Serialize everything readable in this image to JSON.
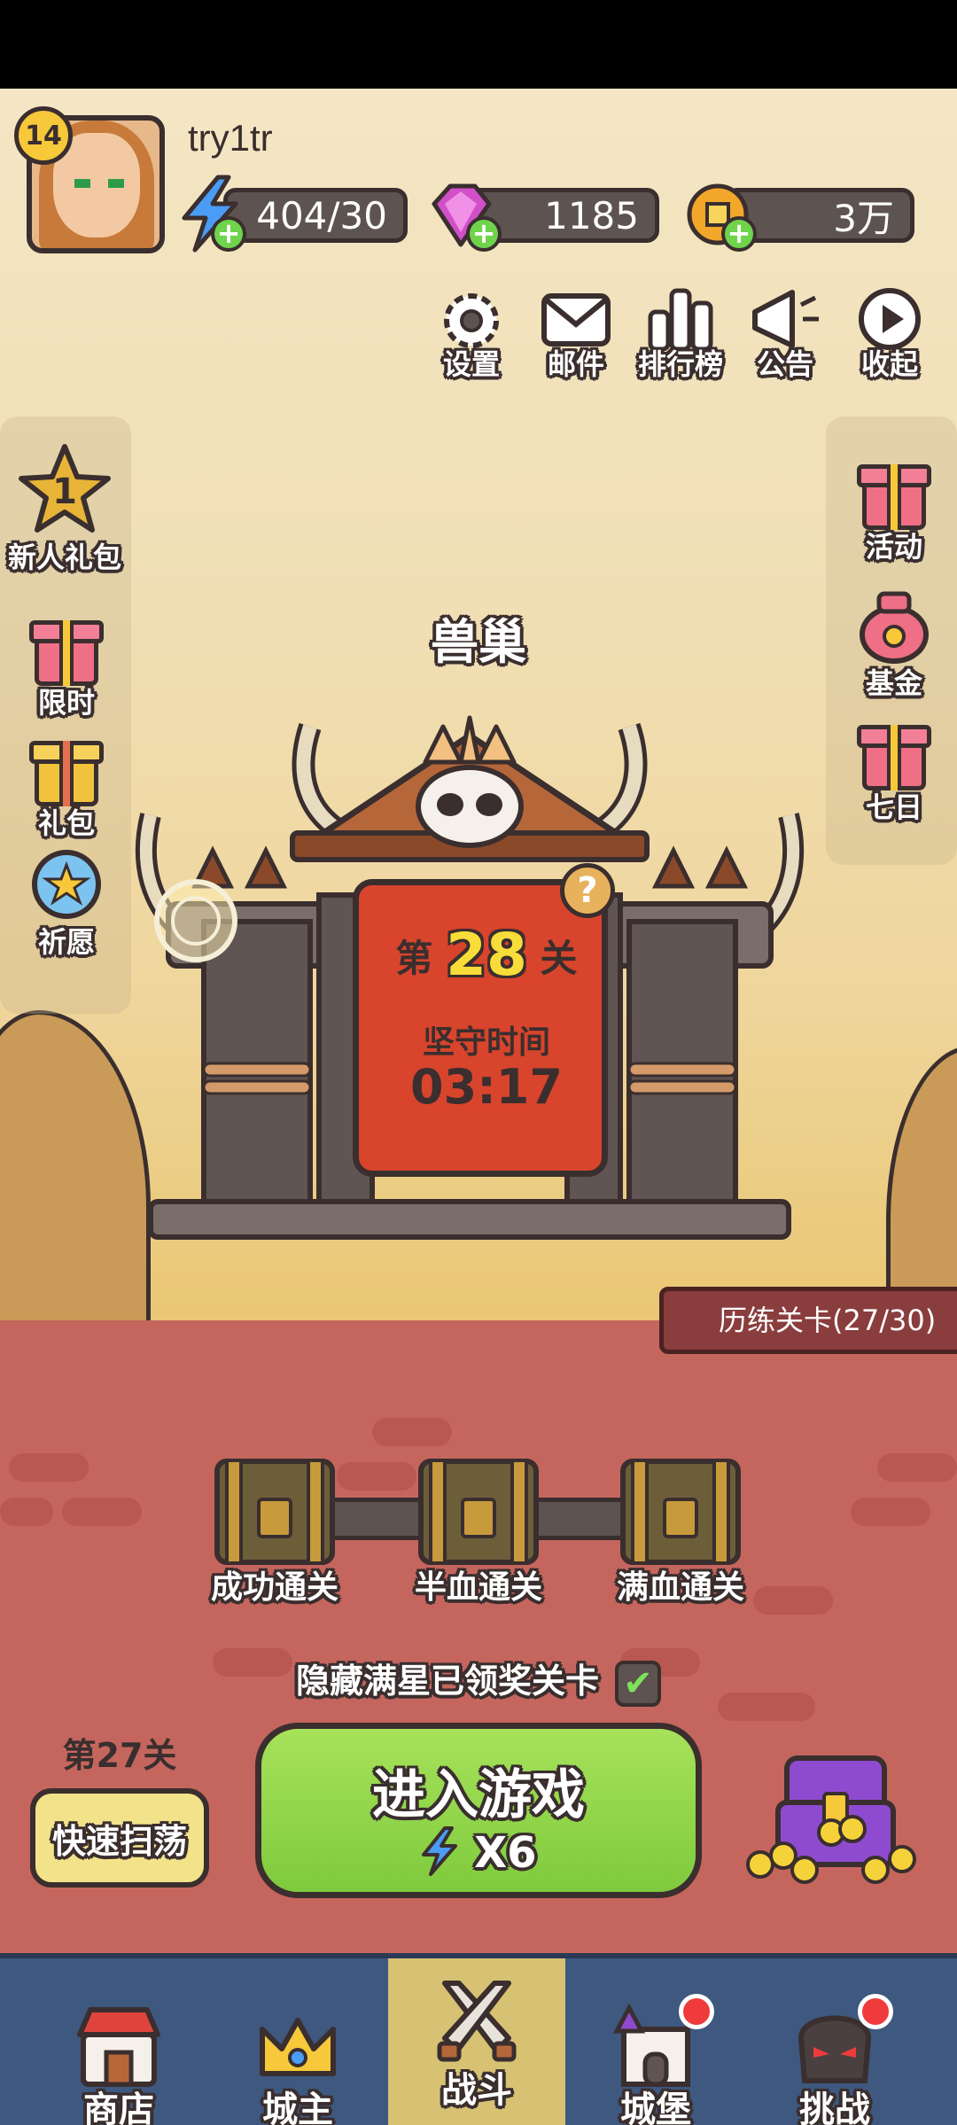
{
  "player": {
    "level": "14",
    "username": "try1tr"
  },
  "resources": {
    "energy": "404/30",
    "gems": "1185",
    "coins": "3万"
  },
  "top_buttons": [
    {
      "label": "设置",
      "icon": "gear-icon"
    },
    {
      "label": "邮件",
      "icon": "mail-icon"
    },
    {
      "label": "排行榜",
      "icon": "leaderboard-icon"
    },
    {
      "label": "公告",
      "icon": "megaphone-icon"
    },
    {
      "label": "收起",
      "icon": "collapse-icon"
    }
  ],
  "left_panel": [
    {
      "label": "新人礼包",
      "badge": "1"
    },
    {
      "label": "限时"
    },
    {
      "label": "礼包"
    },
    {
      "label": "祈愿"
    }
  ],
  "right_panel": [
    {
      "label": "活动"
    },
    {
      "label": "基金"
    },
    {
      "label": "七日"
    }
  ],
  "stage": {
    "name": "兽巢",
    "prefix": "第",
    "number": "28",
    "suffix": "关",
    "hold_label": "坚守时间",
    "hold_time": "03:17",
    "help": "?"
  },
  "trial": {
    "label": "历练关卡(27/30)"
  },
  "chests": [
    {
      "label": "成功通关"
    },
    {
      "label": "半血通关"
    },
    {
      "label": "满血通关"
    }
  ],
  "hide_option": {
    "label": "隐藏满星已领奖关卡",
    "checked": true,
    "check_mark": "✔"
  },
  "sweep": {
    "stage_label": "第27关",
    "button_label": "快速扫荡"
  },
  "enter": {
    "label": "进入游戏",
    "cost": "X6"
  },
  "nav": [
    {
      "label": "商店",
      "active": false
    },
    {
      "label": "城主",
      "active": false
    },
    {
      "label": "战斗",
      "active": true
    },
    {
      "label": "城堡",
      "active": false,
      "notification": true
    },
    {
      "label": "挑战",
      "active": false,
      "notification": true
    }
  ],
  "colors": {
    "outline": "#3a2e2e",
    "sky": "#f0dfb5",
    "ground": "#c5665e",
    "enter_green": "#7fca3d",
    "nav_bg": "#3e587f",
    "nav_active": "#d6c272"
  }
}
